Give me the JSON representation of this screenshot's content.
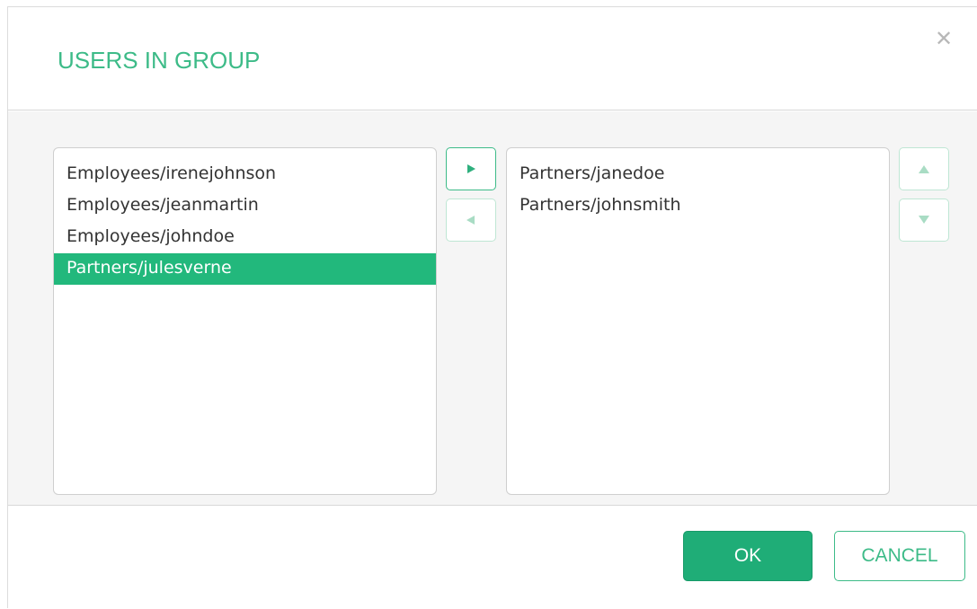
{
  "dialog": {
    "title": "USERS IN GROUP",
    "close_icon": "close-icon",
    "close_glyph": "✕"
  },
  "available_list": {
    "items": [
      {
        "label": "Employees/irenejohnson",
        "selected": false
      },
      {
        "label": "Employees/jeanmartin",
        "selected": false
      },
      {
        "label": "Employees/johndoe",
        "selected": false
      },
      {
        "label": "Partners/julesverne",
        "selected": true
      }
    ]
  },
  "group_list": {
    "items": [
      {
        "label": "Partners/janedoe",
        "selected": false
      },
      {
        "label": "Partners/johnsmith",
        "selected": false
      }
    ]
  },
  "transfer_buttons": {
    "add_icon": "triangle-right-icon",
    "remove_icon": "triangle-left-icon"
  },
  "order_buttons": {
    "up_icon": "triangle-up-icon",
    "down_icon": "triangle-down-icon"
  },
  "footer": {
    "ok_label": "OK",
    "cancel_label": "CANCEL"
  },
  "colors": {
    "accent": "#22b87c",
    "title": "#3dbb88",
    "selected_row": "#22b87c",
    "disabled_arrow": "#a9dcc4"
  }
}
